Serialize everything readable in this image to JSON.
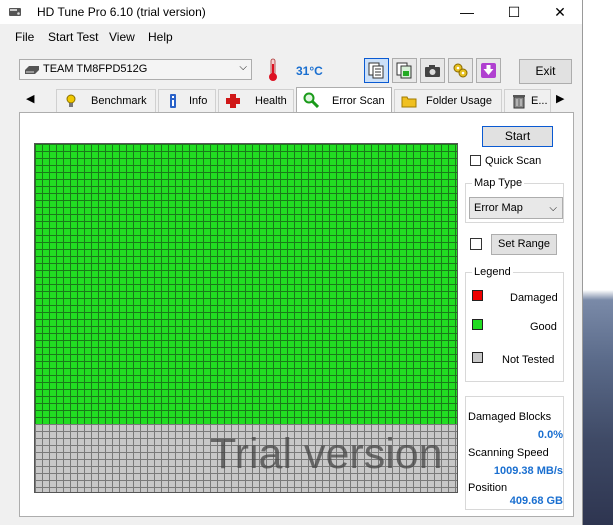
{
  "window": {
    "title": "HD Tune Pro 6.10 (trial version)",
    "controls": {
      "minimize": "—",
      "maximize": "☐",
      "close": "✕"
    }
  },
  "menu": [
    "File",
    "Start Test",
    "View",
    "Help"
  ],
  "toolbar": {
    "drive": "TEAM TM8FPD512G",
    "temperature": "31°C",
    "exit_label": "Exit",
    "icons": [
      "copy-text-icon",
      "copy-image-icon",
      "camera-icon",
      "options-icon",
      "save-icon"
    ]
  },
  "tabs": {
    "items": [
      "Benchmark",
      "Info",
      "Health",
      "Error Scan",
      "Folder Usage",
      "E..."
    ],
    "active": "Error Scan"
  },
  "error_scan": {
    "start_label": "Start",
    "quick_scan_label": "Quick Scan",
    "quick_scan_checked": false,
    "map_type_title": "Map Type",
    "map_type_value": "Error Map",
    "set_range_label": "Set Range",
    "set_range_checked": false,
    "legend": {
      "title": "Legend",
      "damaged": "Damaged",
      "good": "Good",
      "not_tested": "Not Tested"
    },
    "stats": {
      "damaged_blocks_label": "Damaged Blocks",
      "damaged_blocks_value": "0.0%",
      "scanning_speed_label": "Scanning Speed",
      "scanning_speed_value": "1009.38 MB/s",
      "position_label": "Position",
      "position_value": "409.68 GB"
    },
    "watermark": "Trial version",
    "scanned_fraction": 0.8,
    "colors": {
      "good": "#22dd22",
      "damaged": "#ee0000",
      "not_tested": "#c8c8c8"
    }
  }
}
